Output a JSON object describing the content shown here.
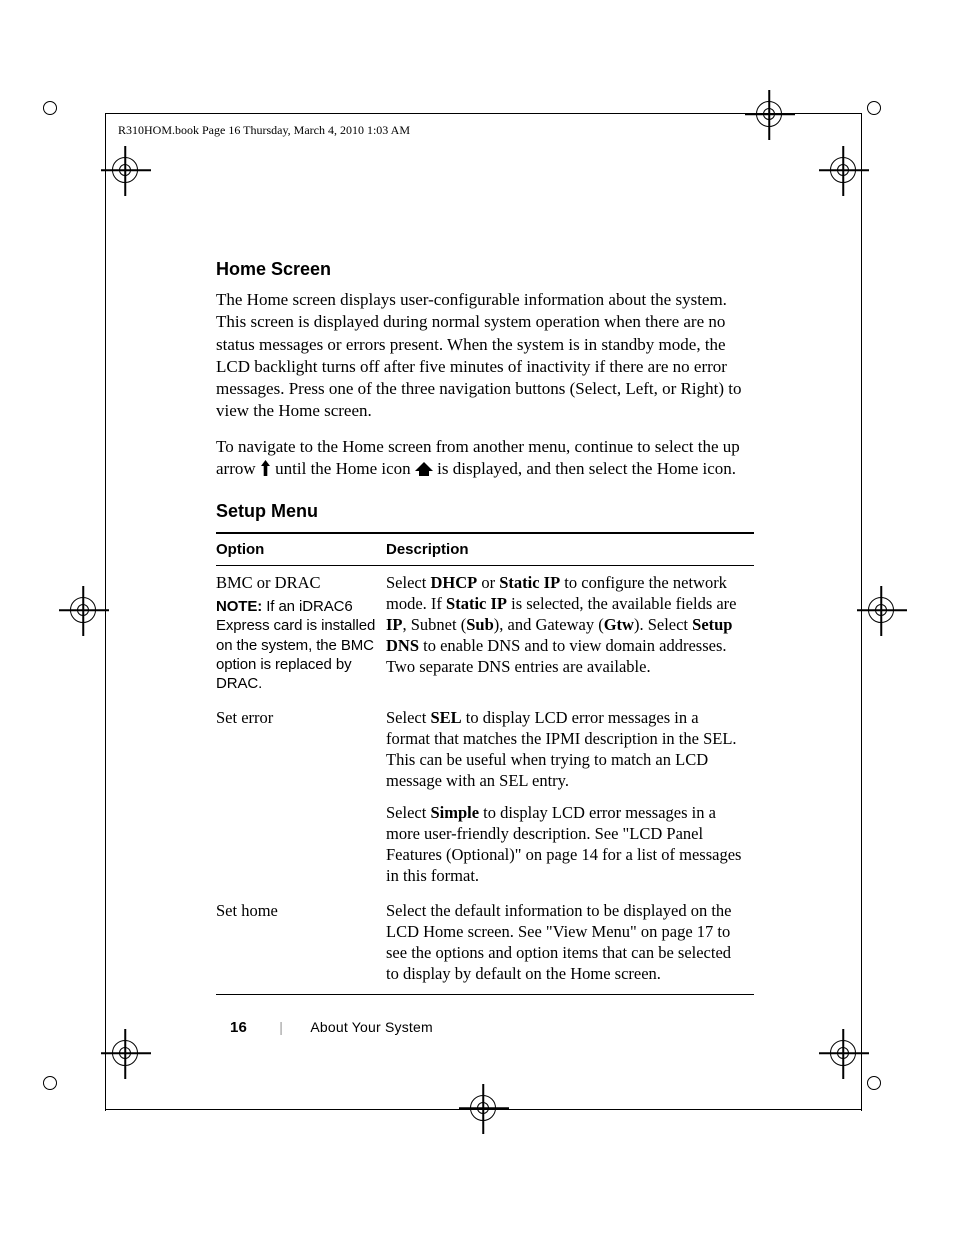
{
  "running_head": "R310HOM.book  Page 16  Thursday, March 4, 2010  1:03 AM",
  "h_home": "Home Screen",
  "p1": "The Home screen displays user-configurable information about the system. This screen is displayed during normal system operation when there are no status messages or errors present. When the system is in standby mode, the LCD backlight turns off after five minutes of inactivity if there are no error messages. Press one of the three navigation buttons (Select, Left, or Right) to view the Home screen.",
  "p2a": "To navigate to the Home screen from another menu, continue to select the up arrow ",
  "p2b": " until the Home icon ",
  "p2c": " is displayed, and then select the Home icon.",
  "h_setup": "Setup Menu",
  "th_option": "Option",
  "th_desc": "Description",
  "rows": {
    "bmc": {
      "opt_line1": "BMC or DRAC",
      "note_label": "NOTE:",
      "note_rest": " If an iDRAC6 Express card is installed on the system, the BMC option is replaced by DRAC.",
      "desc_a": "Select ",
      "desc_b": "DHCP",
      "desc_c": " or ",
      "desc_d": "Static IP",
      "desc_e": " to configure the network mode. If ",
      "desc_f": "Static IP",
      "desc_g": " is selected, the available fields are ",
      "desc_h": "IP",
      "desc_i": ", Subnet (",
      "desc_j": "Sub",
      "desc_k": "), and Gateway (",
      "desc_l": "Gtw",
      "desc_m": "). Select ",
      "desc_n": "Setup DNS",
      "desc_o": " to enable DNS and to view domain addresses. Two separate DNS entries are available."
    },
    "seterr": {
      "opt": "Set error",
      "p1a": "Select ",
      "p1b": "SEL",
      "p1c": " to display LCD error messages in a format that matches the IPMI description in the SEL. This can be useful when trying to match an LCD message with an SEL entry.",
      "p2a": "Select ",
      "p2b": "Simple",
      "p2c": " to display LCD error messages in a more user-friendly description. See \"LCD Panel Features (Optional)\" on page 14 for a list of messages in this format."
    },
    "sethome": {
      "opt": "Set home",
      "desc": "Select the default information to be displayed on the LCD Home screen. See \"View Menu\" on page 17 to see the options and option items that can be selected to display by default on the Home screen."
    }
  },
  "footer": {
    "page": "16",
    "section": "About Your System"
  }
}
